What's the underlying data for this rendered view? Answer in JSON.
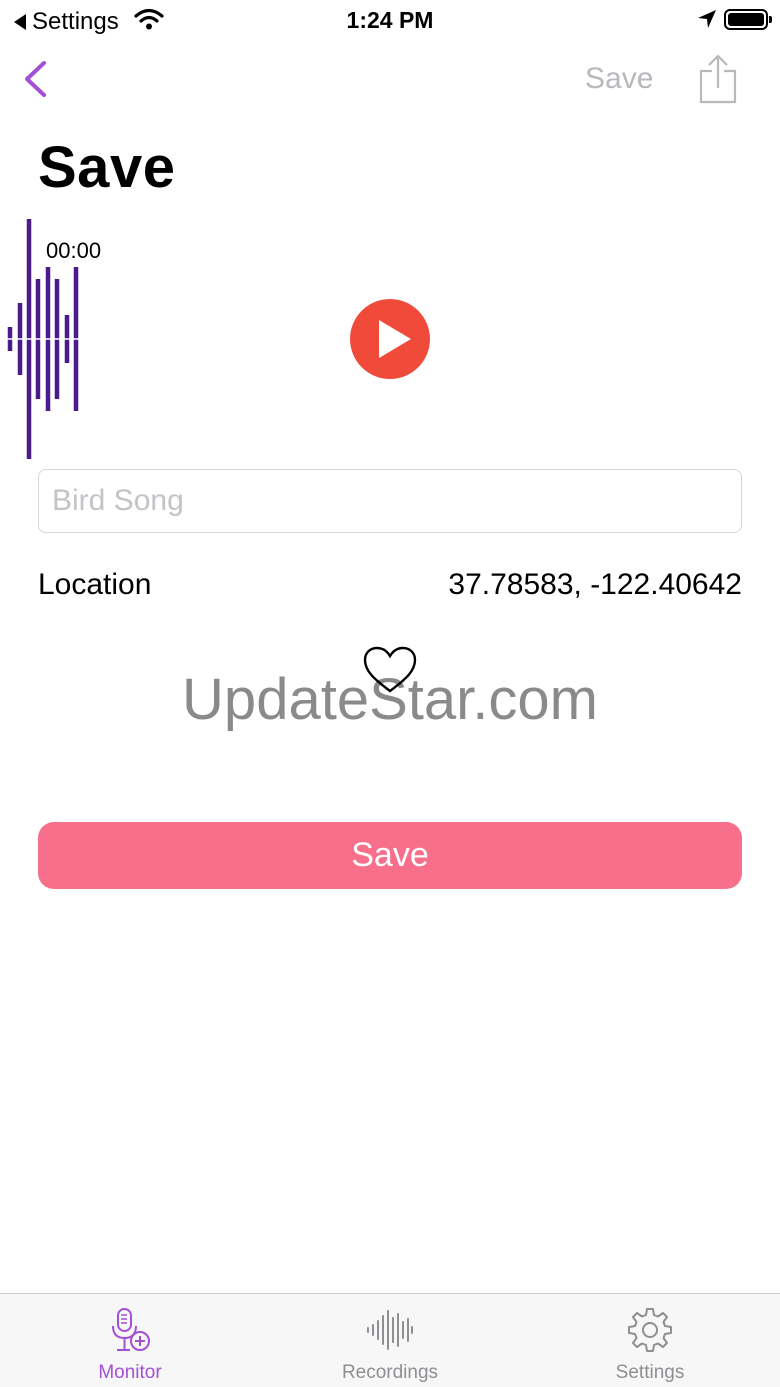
{
  "status_bar": {
    "back_app": "Settings",
    "time": "1:24 PM"
  },
  "nav": {
    "save_label": "Save"
  },
  "page": {
    "title": "Save"
  },
  "player": {
    "time": "00:00"
  },
  "name_field": {
    "placeholder": "Bird Song",
    "value": ""
  },
  "location": {
    "label": "Location",
    "value": "37.78583, -122.40642"
  },
  "watermark": "UpdateStar.com",
  "save_button": {
    "label": "Save"
  },
  "tabs": [
    {
      "label": "Monitor",
      "icon": "mic-plus-icon",
      "active": true
    },
    {
      "label": "Recordings",
      "icon": "waveform-icon",
      "active": false
    },
    {
      "label": "Settings",
      "icon": "gear-icon",
      "active": false
    }
  ],
  "colors": {
    "accent": "#a34fd6",
    "waveform": "#4b1a8c",
    "play": "#f04b3a",
    "save": "#f76f8b"
  }
}
